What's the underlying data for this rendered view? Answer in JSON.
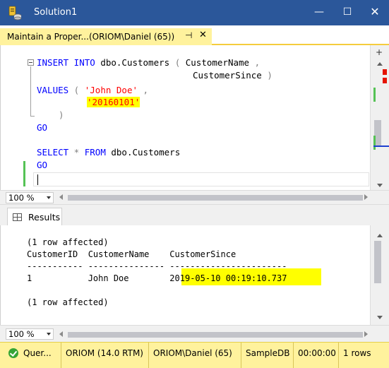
{
  "window": {
    "title": "Solution1",
    "min_glyph": "—",
    "max_glyph": "☐",
    "close_glyph": "✕"
  },
  "document_tab": {
    "title": "Maintain a Proper...(ORIOM\\Daniel (65))",
    "pin_glyph": "⊣",
    "close_glyph": "✕"
  },
  "editor": {
    "lines": [
      {
        "kw1": "INSERT INTO",
        "tx1": " dbo.Customers ",
        "gr1": "(",
        "tx2": " CustomerName ",
        "gr2": ","
      },
      {
        "tx1": "CustomerSince ",
        "gr1": ")"
      },
      {
        "kw1": "VALUES",
        "gr1": " (",
        "str1": " 'John Doe'",
        "gr2": " ,"
      },
      {
        "str1": "'20160101'"
      },
      {
        "gr1": ")"
      },
      {
        "kw1": "GO"
      },
      {
        "kw1": "SELECT",
        "gr1": " *",
        "kw2": " FROM",
        "tx1": " dbo.Customers"
      },
      {
        "kw1": "GO"
      }
    ],
    "split_glyph": "+"
  },
  "editor_zoom": {
    "value": "100 %"
  },
  "results_tab": {
    "label": "Results"
  },
  "results": {
    "lines": [
      "(1 row affected)",
      "CustomerID  CustomerName    CustomerSince",
      "----------- --------------- -----------------------",
      "1           John Doe        2019-05-10 00:19:10.737",
      "",
      "(1 row affected)"
    ]
  },
  "results_zoom": {
    "value": "100 %"
  },
  "status_bar": {
    "query_status": "Quer...",
    "server": "ORIOM (14.0 RTM)",
    "login": "ORIOM\\Daniel (65)",
    "database": "SampleDB",
    "elapsed": "00:00:00",
    "rows": "1 rows"
  },
  "colors": {
    "title_bar": "#2b579a",
    "tab_active": "#fff29d",
    "status_bar": "#fff29d",
    "keyword": "#0000ff",
    "string": "#ff0000",
    "highlight": "#ffff00",
    "change_marker": "#55c255",
    "error_marker": "#e51400"
  }
}
